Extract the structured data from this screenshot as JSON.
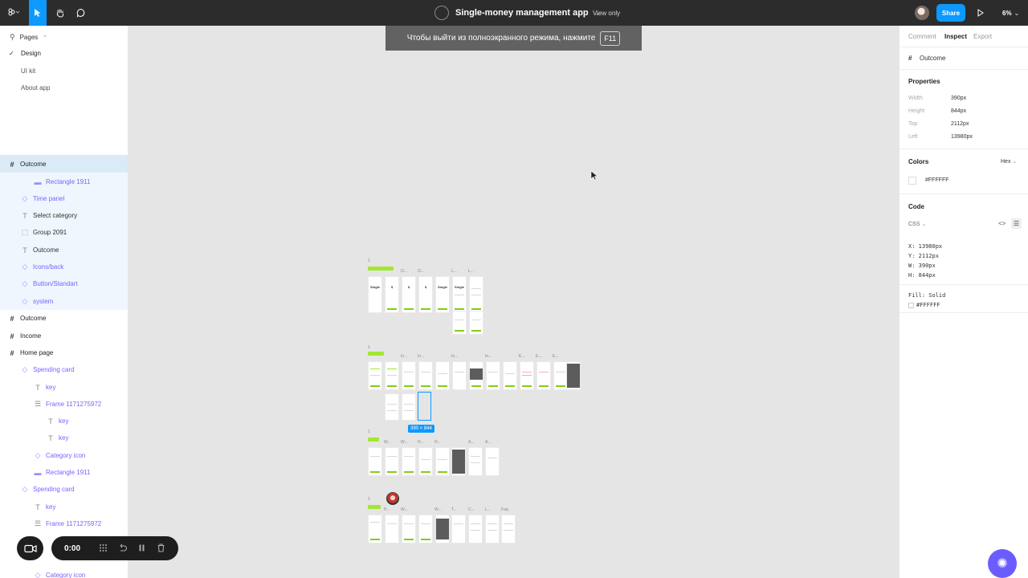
{
  "topbar": {
    "file_name": "Single-money management app",
    "view_mode": "View only",
    "share_label": "Share",
    "zoom_label": "6%"
  },
  "pages": {
    "header": "Pages",
    "items": [
      {
        "label": "Design",
        "selected": true
      },
      {
        "label": "UI kit",
        "selected": false
      },
      {
        "label": "About app",
        "selected": false
      }
    ]
  },
  "layers": [
    {
      "label": "Outcome",
      "kind": "frame",
      "indent": 0,
      "selected": true
    },
    {
      "label": "Rectangle 1911",
      "kind": "rect",
      "indent": 2
    },
    {
      "label": "Time panel",
      "kind": "comp",
      "indent": 1
    },
    {
      "label": "Select category",
      "kind": "text",
      "indent": 1
    },
    {
      "label": "Group 2091",
      "kind": "group",
      "indent": 1
    },
    {
      "label": "Outcome",
      "kind": "text",
      "indent": 1
    },
    {
      "label": "Icons/back",
      "kind": "comp",
      "indent": 1
    },
    {
      "label": "Button/Standart",
      "kind": "comp",
      "indent": 1
    },
    {
      "label": "system",
      "kind": "comp",
      "indent": 1
    },
    {
      "label": "Outcome",
      "kind": "frame",
      "indent": 0
    },
    {
      "label": "Income",
      "kind": "frame",
      "indent": 0
    },
    {
      "label": "Home page",
      "kind": "frame",
      "indent": 0
    },
    {
      "label": "Spending card",
      "kind": "comp",
      "indent": 1
    },
    {
      "label": "key",
      "kind": "text-purple",
      "indent": 2
    },
    {
      "label": "Frame 1171275972",
      "kind": "autolayout",
      "indent": 2
    },
    {
      "label": "key",
      "kind": "text-purple",
      "indent": 3
    },
    {
      "label": "key",
      "kind": "text-purple",
      "indent": 3
    },
    {
      "label": "Category icon",
      "kind": "comp",
      "indent": 2
    },
    {
      "label": "Rectangle 1911",
      "kind": "rect",
      "indent": 2
    },
    {
      "label": "Spending card",
      "kind": "comp",
      "indent": 1
    },
    {
      "label": "key",
      "kind": "text-purple",
      "indent": 2
    },
    {
      "label": "Frame 1171275972",
      "kind": "autolayout",
      "indent": 2
    },
    {
      "label": "Category icon",
      "kind": "comp",
      "indent": 2
    }
  ],
  "canvas": {
    "fullscreen_hint": "Чтобы выйти из полноэкранного режима, нажмите",
    "fullscreen_key": "F11",
    "selection_size": "390 × 844",
    "row_markers": [
      "1",
      "1",
      "1",
      "1"
    ],
    "frame_titles": {
      "row1": [
        "O...",
        "O...",
        "L...",
        "L..."
      ],
      "row2": [
        "In...",
        "In...",
        "In...",
        "In...",
        "E...",
        "E...",
        "E..."
      ],
      "row3": [
        "W...",
        "W...",
        "H...",
        "H...",
        "A...",
        "A..."
      ],
      "row4": [
        "P...",
        "W...",
        "W...",
        "T...",
        "C...",
        "L...",
        "Faq"
      ]
    },
    "mini_texts": [
      "Single",
      "$",
      "$",
      "$",
      "Single",
      "Single"
    ]
  },
  "inspect": {
    "tabs": [
      "Comment",
      "Inspect",
      "Export"
    ],
    "active_tab": "Inspect",
    "layer_name": "Outcome",
    "properties_title": "Properties",
    "properties": [
      {
        "label": "Width",
        "value": "390px"
      },
      {
        "label": "Height",
        "value": "844px"
      },
      {
        "label": "Top",
        "value": "2112px"
      },
      {
        "label": "Left",
        "value": "13980px"
      }
    ],
    "colors_title": "Colors",
    "color_format": "Hex",
    "color_value": "#FFFFFF",
    "code_title": "Code",
    "code_lang": "CSS",
    "code_lines": [
      "X: 13980px",
      "Y: 2112px",
      "W: 390px",
      "H: 844px"
    ],
    "fill_label": "Fill: Solid",
    "fill_value": "#FFFFFF"
  },
  "recorder": {
    "time": "0:00"
  },
  "colors": {
    "accent": "#0d99ff",
    "component": "#7b61ff",
    "lime": "#a3e635",
    "topbar": "#2c2c2c"
  }
}
